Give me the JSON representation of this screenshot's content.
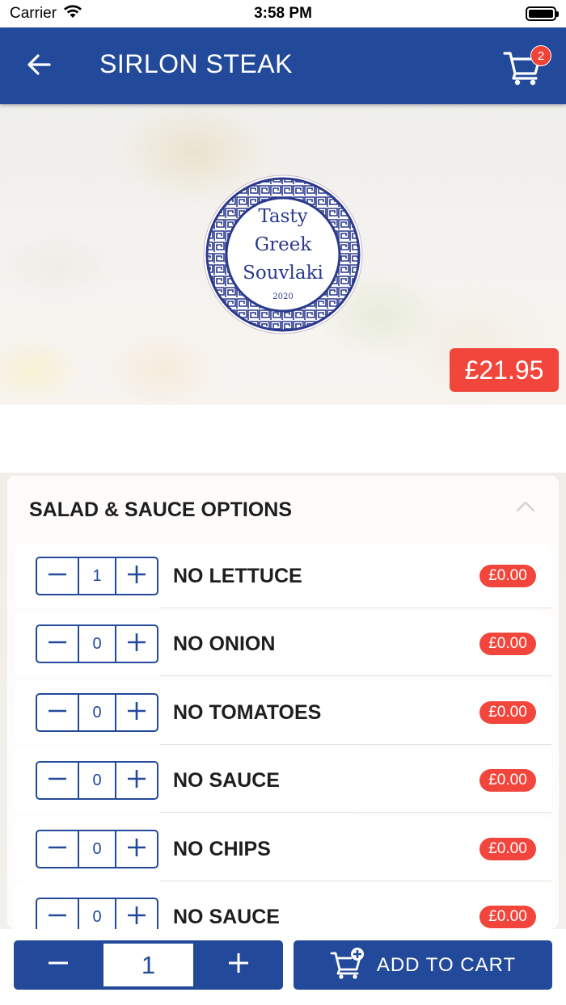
{
  "status_bar": {
    "carrier": "Carrier",
    "time": "3:58 PM"
  },
  "nav": {
    "title": "SIRLON STEAK",
    "cart_count": "2",
    "back_icon": "arrow-left-icon",
    "cart_icon": "shopping-cart-icon"
  },
  "hero": {
    "logo_lines": [
      "Tasty",
      "Greek",
      "Souvlaki"
    ],
    "logo_year": "2020",
    "price": "£21.95"
  },
  "options": {
    "section_title": "SALAD & SAUCE OPTIONS",
    "expanded": true,
    "items": [
      {
        "label": "NO LETTUCE",
        "qty": "1",
        "price": "£0.00"
      },
      {
        "label": "NO ONION",
        "qty": "0",
        "price": "£0.00"
      },
      {
        "label": "NO TOMATOES",
        "qty": "0",
        "price": "£0.00"
      },
      {
        "label": "NO SAUCE",
        "qty": "0",
        "price": "£0.00"
      },
      {
        "label": "NO CHIPS",
        "qty": "0",
        "price": "£0.00"
      },
      {
        "label": "NO SAUCE",
        "qty": "0",
        "price": "£0.00"
      }
    ]
  },
  "bottom": {
    "quantity": "1",
    "add_to_cart_label": "ADD TO CART"
  },
  "colors": {
    "primary": "#234a9a",
    "accent_red": "#f2453b",
    "badge_red": "#f04236"
  }
}
